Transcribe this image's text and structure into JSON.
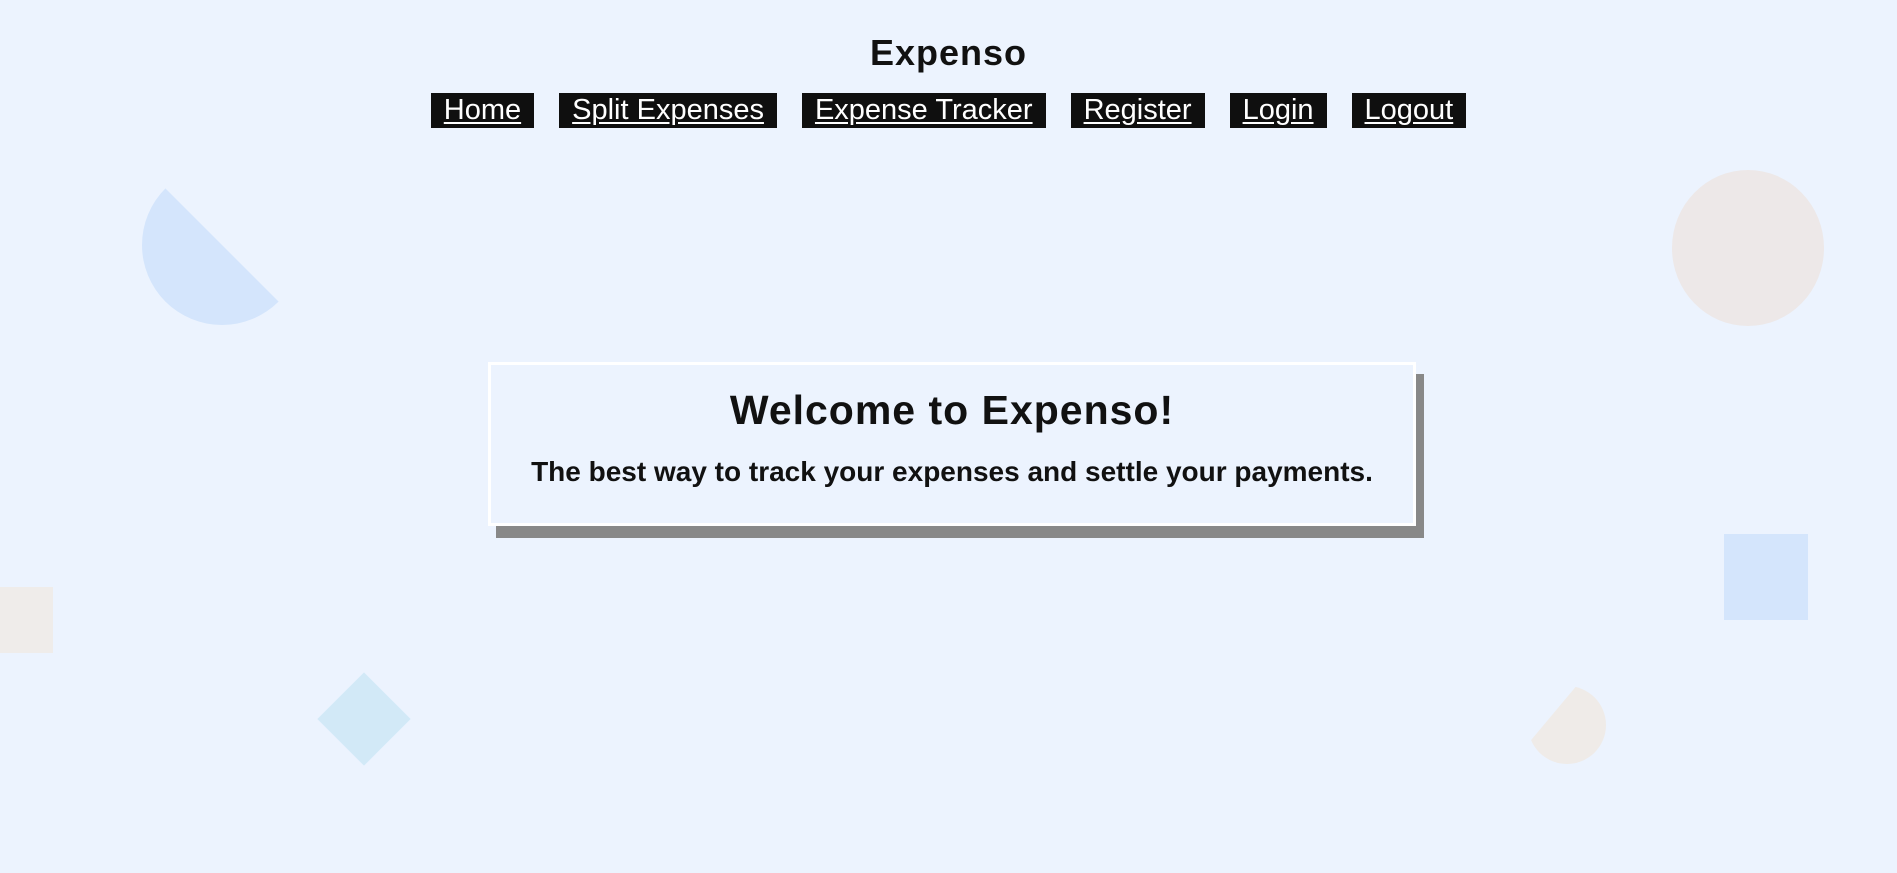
{
  "header": {
    "app_title": "Expenso"
  },
  "nav": {
    "items": [
      {
        "label": "Home"
      },
      {
        "label": "Split Expenses"
      },
      {
        "label": "Expense Tracker"
      },
      {
        "label": "Register"
      },
      {
        "label": "Login"
      },
      {
        "label": "Logout"
      }
    ]
  },
  "welcome": {
    "heading": "Welcome to Expenso!",
    "tagline": "The best way to track your expenses and settle your payments."
  },
  "colors": {
    "background": "#ecf3fe",
    "nav_background": "#0f0f0f",
    "nav_text": "#ffffff",
    "card_border": "#ffffff",
    "card_shadow": "#888888",
    "shape_blue": "#d4e5fc",
    "shape_beige": "#ede8e8"
  }
}
